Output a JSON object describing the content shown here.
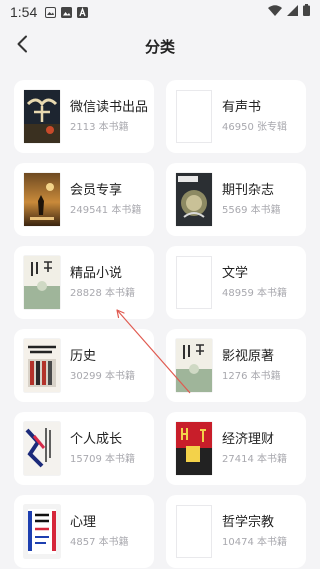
{
  "status": {
    "time": "1:54",
    "icons": [
      "image-icon",
      "picture-icon",
      "a-icon"
    ],
    "right_icons": [
      "wifi-icon",
      "signal-icon",
      "battery-icon"
    ]
  },
  "header": {
    "title": "分类",
    "back_icon": "chevron-left-icon"
  },
  "categories": [
    {
      "name": "微信读书出品",
      "count": "2113 本书籍",
      "cover": "dark-fantasy"
    },
    {
      "name": "有声书",
      "count": "46950 张专辑",
      "cover": "blank"
    },
    {
      "name": "会员专享",
      "count": "249541 本书籍",
      "cover": "desert-figure"
    },
    {
      "name": "期刊杂志",
      "count": "5569 本书籍",
      "cover": "magazine"
    },
    {
      "name": "精品小说",
      "count": "28828 本书籍",
      "cover": "novel-green"
    },
    {
      "name": "文学",
      "count": "48959 本书籍",
      "cover": "blank"
    },
    {
      "name": "历史",
      "count": "30299 本书籍",
      "cover": "history-red"
    },
    {
      "name": "影视原著",
      "count": "1276 本书籍",
      "cover": "novel-green"
    },
    {
      "name": "个人成长",
      "count": "15709 本书籍",
      "cover": "growth-blue"
    },
    {
      "name": "经济理财",
      "count": "27414 本书籍",
      "cover": "finance-red"
    },
    {
      "name": "心理",
      "count": "4857 本书籍",
      "cover": "psych-stripes"
    },
    {
      "name": "哲学宗教",
      "count": "10474 本书籍",
      "cover": "blank"
    }
  ],
  "colors": {
    "background": "#f4f4f6",
    "card": "#ffffff",
    "count_text": "#a8a8ae",
    "annotation_arrow": "#e05a50"
  }
}
